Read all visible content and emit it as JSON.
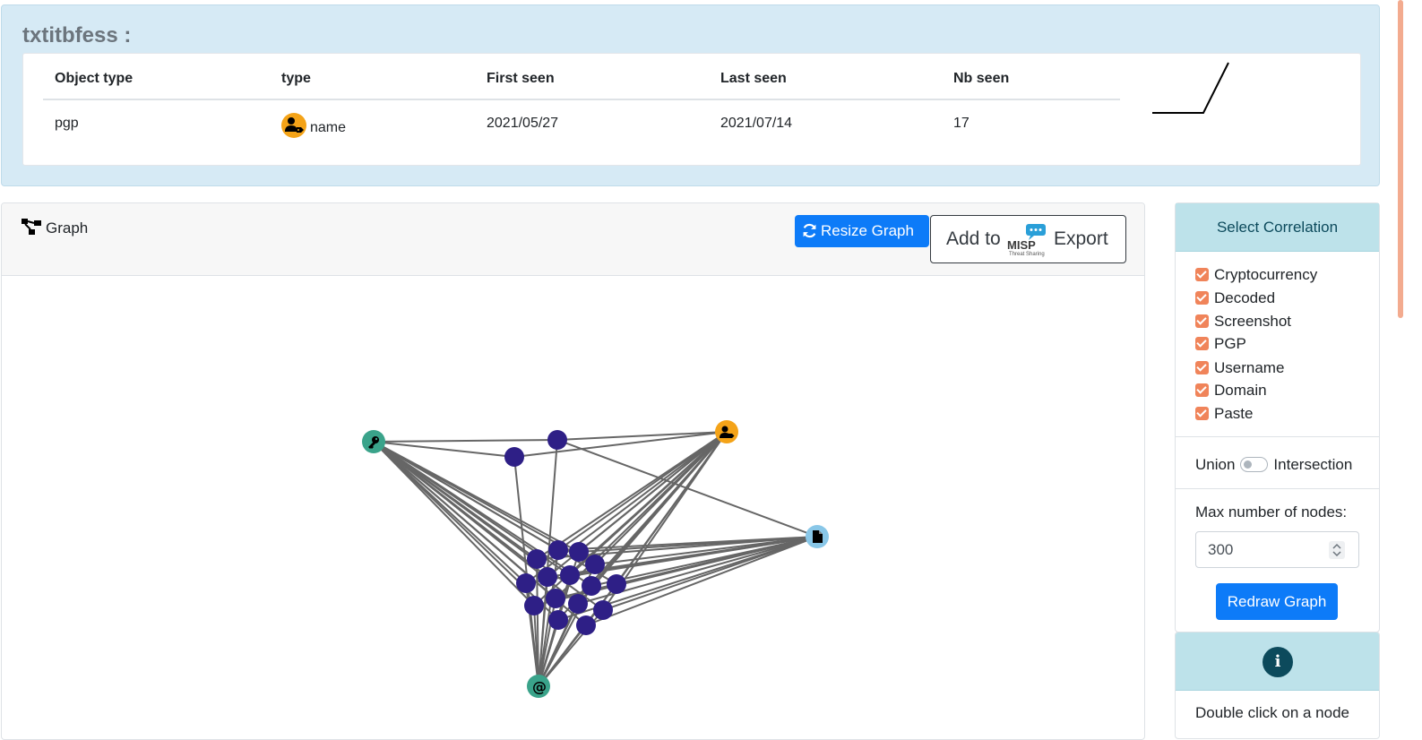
{
  "page": {
    "title": "txtitbfess :"
  },
  "table": {
    "headers": [
      "Object type",
      "type",
      "First seen",
      "Last seen",
      "Nb seen"
    ],
    "row": {
      "object_type": "pgp",
      "type_icon": "user-tag-icon",
      "type": "name",
      "first_seen": "2021/05/27",
      "last_seen": "2021/07/14",
      "nb_seen": "17"
    }
  },
  "graph": {
    "title": "Graph",
    "title_icon": "project-diagram-icon",
    "resize_label": "Resize Graph",
    "resize_icon": "sync-icon",
    "misp": {
      "add_label": "Add to",
      "logo_text": "MISP",
      "logo_subtext": "Threat Sharing",
      "export_label": "Export"
    },
    "colors": {
      "node_main": "#2e1f86",
      "node_green": "#3aa38a",
      "node_orange": "#f4a318",
      "node_light_blue": "#89c7e8",
      "edge": "#666666"
    },
    "hub_nodes": [
      {
        "kind": "key-icon"
      },
      {
        "kind": "user-tag-icon"
      },
      {
        "kind": "file-icon"
      },
      {
        "kind": "at-icon"
      }
    ]
  },
  "correlation": {
    "title": "Select Correlation",
    "options": [
      {
        "label": "Cryptocurrency",
        "checked": true
      },
      {
        "label": "Decoded",
        "checked": true
      },
      {
        "label": "Screenshot",
        "checked": true
      },
      {
        "label": "PGP",
        "checked": true
      },
      {
        "label": "Username",
        "checked": true
      },
      {
        "label": "Domain",
        "checked": true
      },
      {
        "label": "Paste",
        "checked": true
      }
    ],
    "union_label": "Union",
    "intersection_label": "Intersection",
    "toggle_on": false,
    "max_nodes_label": "Max number of nodes:",
    "max_nodes_value": "300",
    "redraw_label": "Redraw Graph"
  },
  "info": {
    "icon": "info-icon",
    "text": "Double click on a node"
  }
}
